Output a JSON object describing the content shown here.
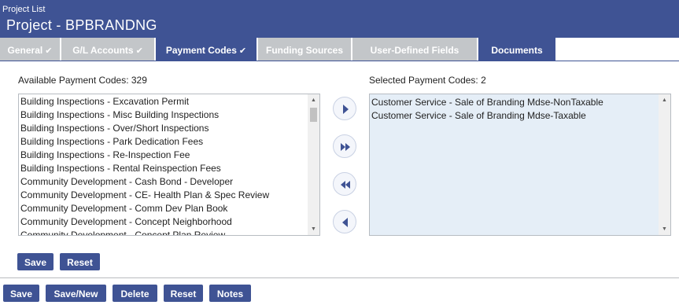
{
  "header": {
    "breadcrumb": "Project List",
    "title": "Project - BPBRANDNG"
  },
  "tabs": [
    {
      "label": "General",
      "checked": true
    },
    {
      "label": "G/L Accounts",
      "checked": true
    },
    {
      "label": "Payment Codes",
      "checked": true,
      "active": true
    },
    {
      "label": "Funding Sources",
      "checked": false
    },
    {
      "label": "User-Defined Fields",
      "checked": false
    },
    {
      "label": "Documents",
      "checked": false
    }
  ],
  "check_glyph": "✔",
  "available": {
    "label": "Available Payment Codes: 329",
    "items": [
      "Building Inspections - Excavation Permit",
      "Building Inspections - Misc Building Inspections",
      "Building Inspections - Over/Short Inspections",
      "Building Inspections - Park Dedication Fees",
      "Building Inspections - Re-Inspection Fee",
      "Building Inspections - Rental Reinspection Fees",
      "Community Development - Cash Bond - Developer",
      "Community Development - CE- Health Plan & Spec Review",
      "Community Development - Comm Dev Plan Book",
      "Community Development - Concept Neighborhood",
      "Community Development - Concept Plan Review"
    ]
  },
  "selected": {
    "label": "Selected Payment Codes: 2",
    "items": [
      "Customer Service - Sale of Branding Mdse-NonTaxable",
      "Customer Service - Sale of Branding Mdse-Taxable"
    ]
  },
  "move_buttons": [
    {
      "name": "move-right-icon"
    },
    {
      "name": "move-all-right-icon"
    },
    {
      "name": "move-all-left-icon"
    },
    {
      "name": "move-left-icon"
    }
  ],
  "panel_buttons": {
    "save": "Save",
    "reset": "Reset"
  },
  "footer_buttons": {
    "save": "Save",
    "save_new": "Save/New",
    "delete": "Delete",
    "reset": "Reset",
    "notes": "Notes"
  },
  "colors": {
    "primary": "#3f5394",
    "inactive_tab": "#c3c6c9",
    "selected_list_bg": "#e5eef7"
  }
}
